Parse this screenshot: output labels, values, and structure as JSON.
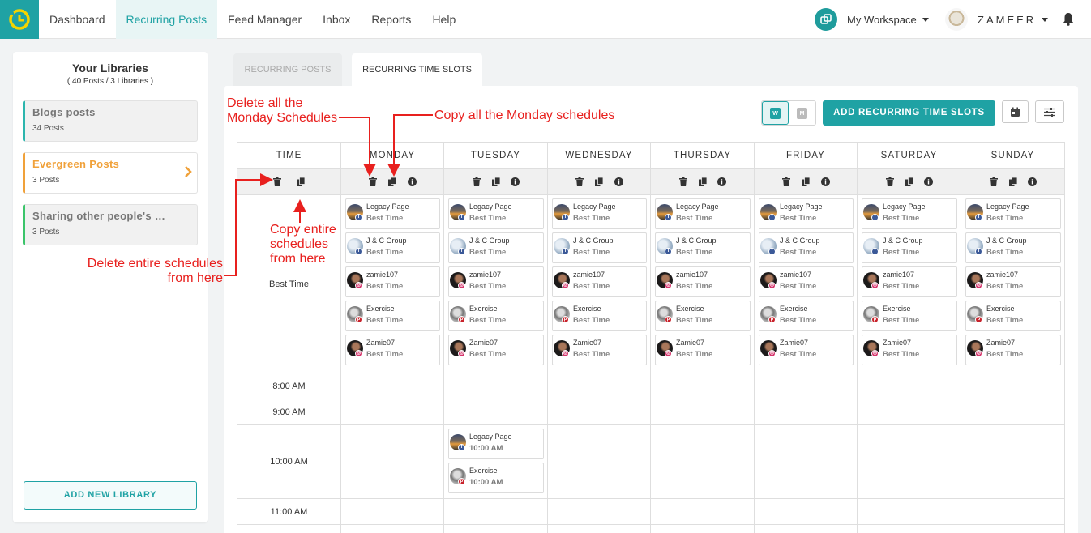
{
  "nav": {
    "items": [
      "Dashboard",
      "Recurring Posts",
      "Feed Manager",
      "Inbox",
      "Reports",
      "Help"
    ],
    "active": "Recurring Posts",
    "workspace": "My Workspace",
    "user": "ZAMEER"
  },
  "sidebar": {
    "title": "Your Libraries",
    "subtitle": "( 40 Posts / 3 Libraries )",
    "libraries": [
      {
        "name": "Blogs posts",
        "count": "34 Posts",
        "accent": "#2cb5ad"
      },
      {
        "name": "Evergreen Posts",
        "count": "3 Posts",
        "accent": "#f0a13a"
      },
      {
        "name": "Sharing other people's c...",
        "count": "3 Posts",
        "accent": "#3bc46a"
      }
    ],
    "add_button": "ADD NEW LIBRARY"
  },
  "tabs": {
    "recurring_posts": "RECURRING POSTS",
    "recurring_time_slots": "RECURRING TIME SLOTS"
  },
  "toolbar": {
    "weekly_label": "W",
    "monthly_label": "M",
    "add_slots": "ADD RECURRING TIME SLOTS"
  },
  "grid": {
    "headers": [
      "TIME",
      "MONDAY",
      "TUESDAY",
      "WEDNESDAY",
      "THURSDAY",
      "FRIDAY",
      "SATURDAY",
      "SUNDAY"
    ],
    "best_time_label": "Best Time",
    "best_time_slots": [
      {
        "name": "Legacy Page",
        "time": "Best Time",
        "network": "facebook"
      },
      {
        "name": "J & C Group",
        "time": "Best Time",
        "network": "facebook"
      },
      {
        "name": "zamie107",
        "time": "Best Time",
        "network": "instagram"
      },
      {
        "name": "Exercise",
        "time": "Best Time",
        "network": "pinterest"
      },
      {
        "name": "Zamie07",
        "time": "Best Time",
        "network": "instagram"
      }
    ],
    "time_rows": [
      "8:00 AM",
      "9:00 AM",
      "10:00 AM",
      "11:00 AM"
    ],
    "tuesday_10am": [
      {
        "name": "Legacy Page",
        "time": "10:00 AM",
        "network": "facebook"
      },
      {
        "name": "Exercise",
        "time": "10:00 AM",
        "network": "pinterest"
      }
    ]
  },
  "annotations": {
    "delete_monday": "Delete all the\nMonday Schedules",
    "copy_monday": "Copy all the Monday schedules",
    "copy_entire": "Copy entire\nschedules\nfrom here",
    "delete_entire": "Delete entire schedules\nfrom here"
  },
  "colors": {
    "brand": "#1fa2a4",
    "annotation": "#e8201e",
    "evergreen": "#f0a13a"
  }
}
